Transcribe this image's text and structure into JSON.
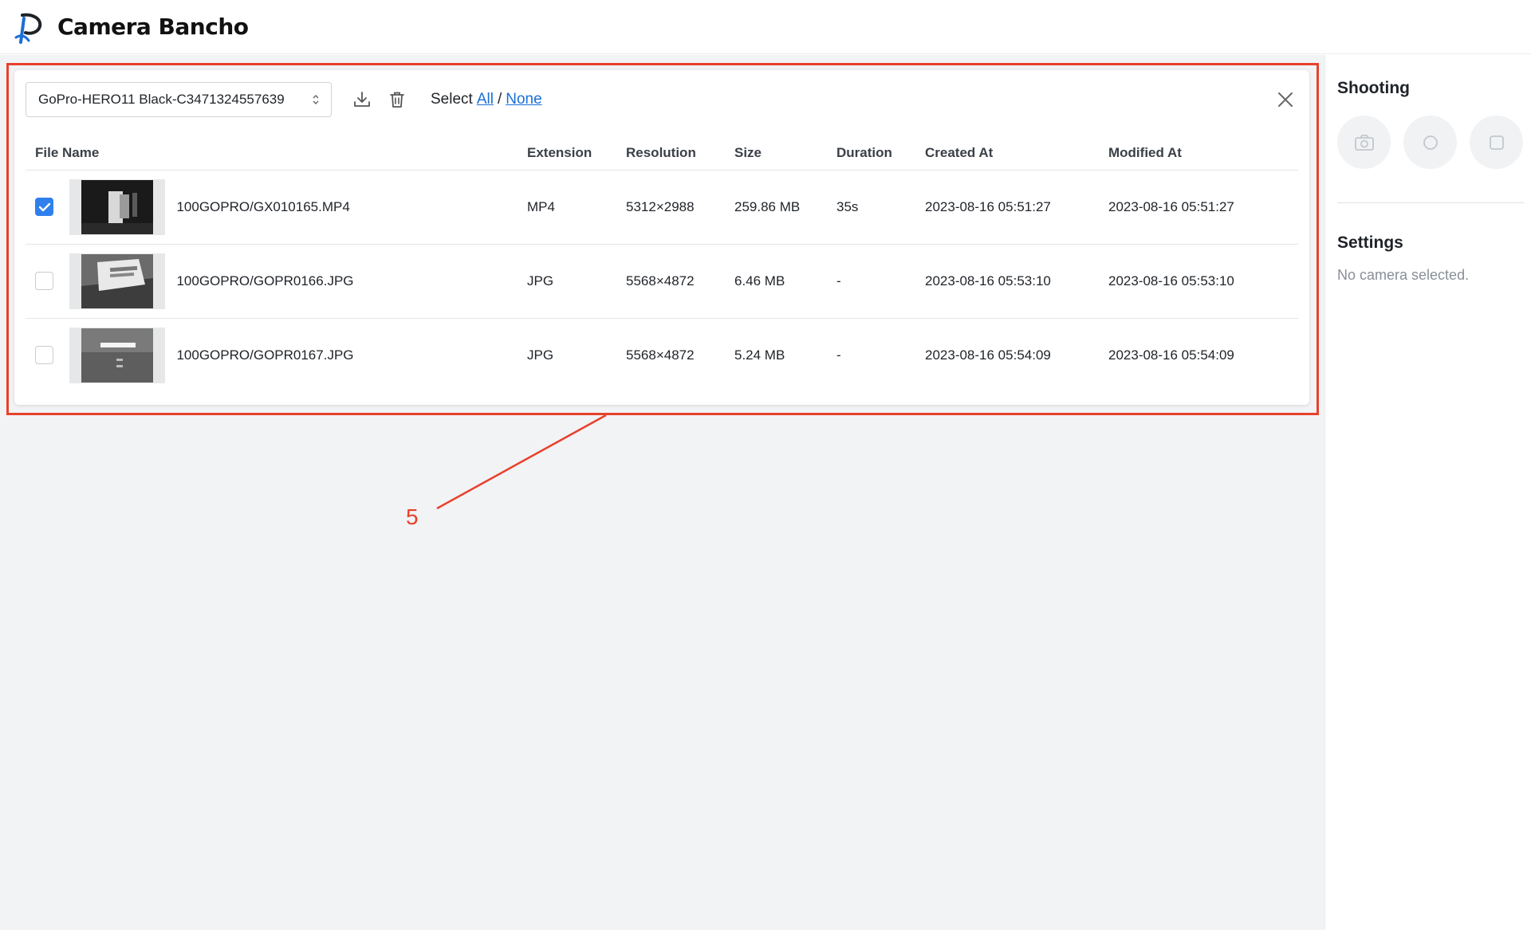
{
  "app": {
    "title": "Camera Bancho"
  },
  "toolbar": {
    "camera_select_value": "GoPro-HERO11 Black-C3471324557639",
    "select_label": "Select",
    "select_all": "All",
    "select_separator": "/",
    "select_none": "None"
  },
  "table": {
    "headers": [
      "File Name",
      "Extension",
      "Resolution",
      "Size",
      "Duration",
      "Created At",
      "Modified At"
    ],
    "rows": [
      {
        "checked": true,
        "file_name": "100GOPRO/GX010165.MP4",
        "extension": "MP4",
        "resolution": "5312×2988",
        "size": "259.86 MB",
        "duration": "35s",
        "created_at": "2023-08-16 05:51:27",
        "modified_at": "2023-08-16 05:51:27"
      },
      {
        "checked": false,
        "file_name": "100GOPRO/GOPR0166.JPG",
        "extension": "JPG",
        "resolution": "5568×4872",
        "size": "6.46 MB",
        "duration": "-",
        "created_at": "2023-08-16 05:53:10",
        "modified_at": "2023-08-16 05:53:10"
      },
      {
        "checked": false,
        "file_name": "100GOPRO/GOPR0167.JPG",
        "extension": "JPG",
        "resolution": "5568×4872",
        "size": "5.24 MB",
        "duration": "-",
        "created_at": "2023-08-16 05:54:09",
        "modified_at": "2023-08-16 05:54:09"
      }
    ]
  },
  "sidebar": {
    "shooting_title": "Shooting",
    "settings_title": "Settings",
    "settings_empty": "No camera selected."
  },
  "annotation": {
    "number": "5",
    "color": "#e8412c"
  },
  "colors": {
    "accent": "#2f80ed",
    "link": "#1a6fd6",
    "main_bg": "#f2f3f5"
  }
}
